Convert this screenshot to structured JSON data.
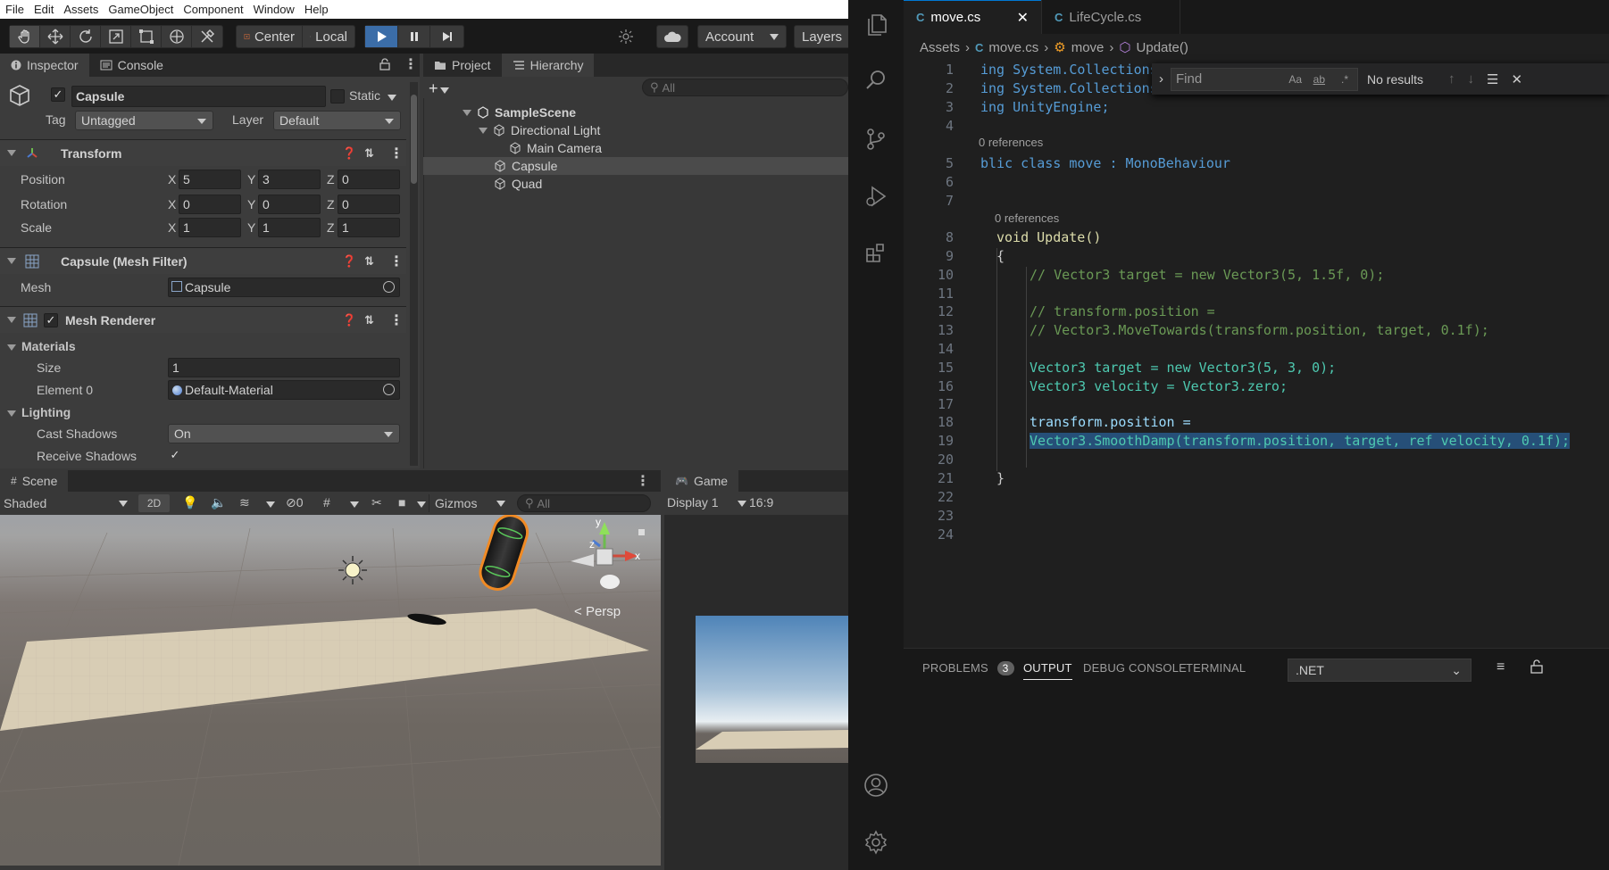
{
  "unity": {
    "menu": [
      "File",
      "Edit",
      "Assets",
      "GameObject",
      "Component",
      "Window",
      "Help"
    ],
    "toolbar": {
      "pivot": "Center",
      "space": "Local",
      "account": "Account",
      "layers": "Layers"
    },
    "inspector": {
      "tabs": [
        "Inspector",
        "Console"
      ],
      "object_name": "Capsule",
      "static_label": "Static",
      "tag_label": "Tag",
      "tag_value": "Untagged",
      "layer_label": "Layer",
      "layer_value": "Default",
      "transform": {
        "title": "Transform",
        "rows": [
          {
            "label": "Position",
            "x": "5",
            "y": "3",
            "z": "0"
          },
          {
            "label": "Rotation",
            "x": "0",
            "y": "0",
            "z": "0"
          },
          {
            "label": "Scale",
            "x": "1",
            "y": "1",
            "z": "1"
          }
        ]
      },
      "mesh_filter": {
        "title": "Capsule (Mesh Filter)",
        "mesh_label": "Mesh",
        "mesh_value": "Capsule"
      },
      "mesh_renderer": {
        "title": "Mesh Renderer",
        "materials": "Materials",
        "size_label": "Size",
        "size_value": "1",
        "element_label": "Element 0",
        "element_value": "Default-Material",
        "lighting": "Lighting",
        "cast_label": "Cast Shadows",
        "cast_value": "On",
        "receive_label": "Receive Shadows"
      }
    },
    "hierarchy": {
      "tabs": [
        "Project",
        "Hierarchy"
      ],
      "search_placeholder": "All",
      "items": [
        "SampleScene",
        "Directional Light",
        "Main Camera",
        "Capsule",
        "Quad"
      ]
    },
    "scene": {
      "tab": "Scene",
      "shading": "Shaded",
      "mode_2d": "2D",
      "hidden_count": "0",
      "gizmos": "Gizmos",
      "search_placeholder": "All",
      "persp": "Persp"
    },
    "game": {
      "tab": "Game",
      "display": "Display 1",
      "aspect": "16:9"
    }
  },
  "vscode": {
    "tabs": [
      {
        "label": "move.cs",
        "active": true
      },
      {
        "label": "LifeCycle.cs",
        "active": false
      }
    ],
    "breadcrumbs": [
      "Assets",
      "move.cs",
      "move",
      "Update()"
    ],
    "find": {
      "placeholder": "Find",
      "status": "No results"
    },
    "lens_refs": "0 references",
    "panel": {
      "tabs": [
        "PROBLEMS",
        "OUTPUT",
        "DEBUG CONSOLE",
        "TERMINAL"
      ],
      "problems_count": "3",
      "output_channel": ".NET"
    },
    "code_lines": [
      {
        "n": "1",
        "text": "ing System.Collections;"
      },
      {
        "n": "2",
        "text": "ing System.Collections.Generic;"
      },
      {
        "n": "3",
        "text": "ing UnityEngine;"
      },
      {
        "n": "4",
        "text": ""
      },
      {
        "n": "5",
        "text": "blic class move : MonoBehaviour"
      },
      {
        "n": "6",
        "text": ""
      },
      {
        "n": "7",
        "text": ""
      },
      {
        "n": "8",
        "text": "void Update()"
      },
      {
        "n": "9",
        "text": "{"
      },
      {
        "n": "10",
        "text": "// Vector3 target = new Vector3(5, 1.5f, 0);"
      },
      {
        "n": "11",
        "text": ""
      },
      {
        "n": "12",
        "text": "// transform.position ="
      },
      {
        "n": "13",
        "text": "// Vector3.MoveTowards(transform.position, target, 0.1f);"
      },
      {
        "n": "14",
        "text": ""
      },
      {
        "n": "15",
        "text": "Vector3 target = new Vector3(5, 3, 0);"
      },
      {
        "n": "16",
        "text": "Vector3 velocity = Vector3.zero;"
      },
      {
        "n": "17",
        "text": ""
      },
      {
        "n": "18",
        "text": "transform.position ="
      },
      {
        "n": "19",
        "text": "Vector3.SmoothDamp(transform.position, target, ref velocity, 0.1f);"
      },
      {
        "n": "20",
        "text": ""
      },
      {
        "n": "21",
        "text": "}"
      },
      {
        "n": "22",
        "text": ""
      },
      {
        "n": "23",
        "text": ""
      },
      {
        "n": "24",
        "text": ""
      }
    ]
  }
}
